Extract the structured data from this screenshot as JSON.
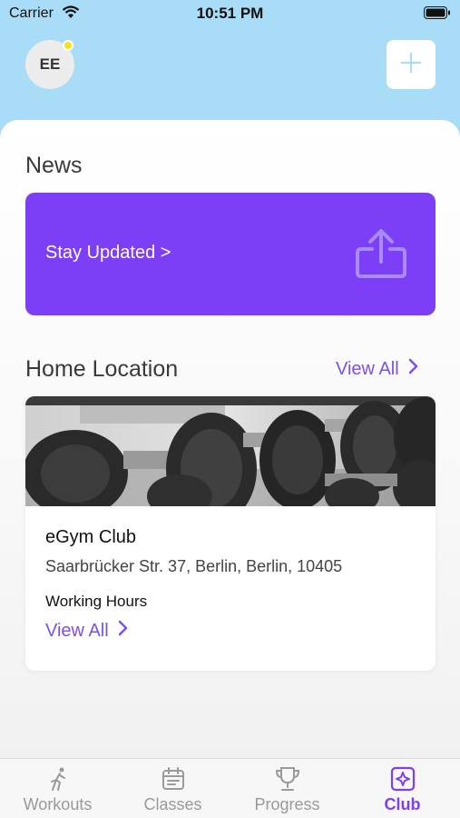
{
  "status_bar": {
    "carrier": "Carrier",
    "time": "10:51 PM",
    "wifi_icon": "wifi-icon",
    "battery_icon": "battery-icon"
  },
  "header": {
    "avatar_initials": "EE",
    "avatar_badge_color": "#f6e21a",
    "add_icon": "plus-icon"
  },
  "news": {
    "title": "News",
    "card_label": "Stay Updated >",
    "card_color": "#7c3ff6",
    "share_icon": "share-icon"
  },
  "home_location": {
    "title": "Home Location",
    "view_all_label": "View All",
    "club": {
      "name": "eGym Club",
      "address": "Saarbrücker Str. 37, Berlin, Berlin, 10405",
      "hours_label": "Working Hours",
      "hours_view_all": "View All",
      "image": "dumbbell-rack-photo"
    }
  },
  "tab_bar": {
    "tabs": [
      {
        "label": "Workouts",
        "icon": "running-person-icon"
      },
      {
        "label": "Classes",
        "icon": "calendar-icon"
      },
      {
        "label": "Progress",
        "icon": "trophy-icon"
      },
      {
        "label": "Club",
        "icon": "club-icon"
      }
    ],
    "active_index": 3,
    "accent": "#7c3ff6"
  }
}
